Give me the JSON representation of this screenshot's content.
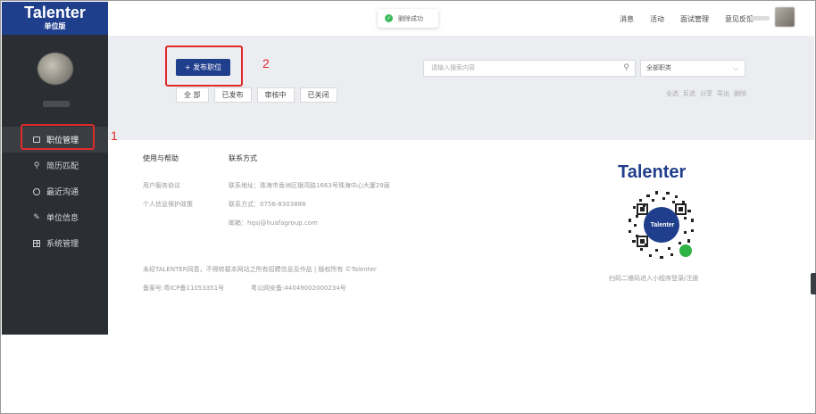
{
  "brand": {
    "name": "Talenter",
    "edition": "单位版"
  },
  "sidebar": {
    "items": [
      {
        "label": "职位管理",
        "icon": "briefcase-icon",
        "active": true
      },
      {
        "label": "简历匹配",
        "icon": "search-icon",
        "active": false
      },
      {
        "label": "最近沟通",
        "icon": "chat-icon",
        "active": false
      },
      {
        "label": "单位信息",
        "icon": "edit-icon",
        "active": false
      },
      {
        "label": "系统管理",
        "icon": "grid-icon",
        "active": false
      }
    ]
  },
  "toast": {
    "text": "删除成功",
    "icon": "success-icon"
  },
  "topnav": {
    "items": [
      "消息",
      "活动",
      "面试管理",
      "意见反馈"
    ]
  },
  "main": {
    "publish_label": "+ 发布职位",
    "filters": [
      "全 部",
      "已发布",
      "审核中",
      "已关闭"
    ],
    "search": {
      "placeholder": "请输入搜索内容"
    },
    "category_select": {
      "value": "全部职类"
    },
    "actions": [
      "全选",
      "反选",
      "分享",
      "导出",
      "删除"
    ]
  },
  "annotations": {
    "one": "1",
    "two": "2"
  },
  "footer": {
    "help_title": "使用与帮助",
    "help_links": [
      "用户服务协议",
      "个人信息保护政策"
    ],
    "contact_title": "联系方式",
    "contact_lines": [
      "联系地址：珠海市香洲区银湾路1663号珠海中心大厦29层",
      "联系方式：0756-8303888",
      "邮箱：hqsj@huafagroup.com"
    ],
    "copyright": "未经TALENTER同意，不得转载本网站之所有招聘信息及作品 | 版权所有 ©Talenter",
    "icp": "备案号:粤ICP备11053351号",
    "police": "粤公网安备:44049002000234号",
    "logo_text": "Talenter",
    "qr_center": "Talenter",
    "qr_caption": "扫码二维码进入小程序登录/注册"
  },
  "colors": {
    "brand_blue": "#1f3e8c",
    "sidebar_bg": "#2b2f33",
    "annotation_red": "#e02a2a",
    "success_green": "#3dbb5c"
  }
}
